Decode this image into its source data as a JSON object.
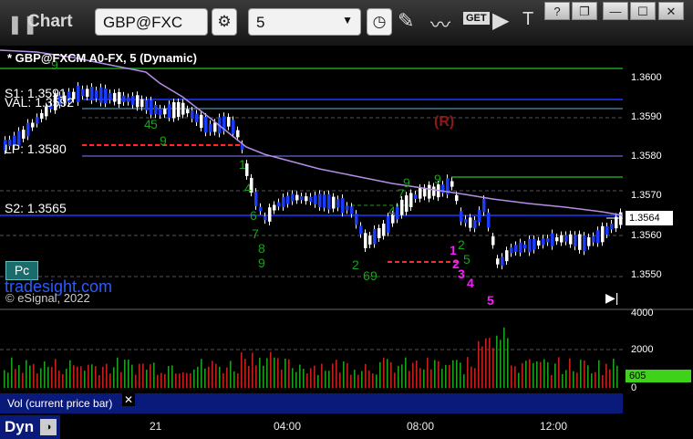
{
  "window": {
    "title": "Chart",
    "symbol": "GBP@FXC",
    "interval": "5",
    "win_buttons": [
      "?",
      "❐",
      "—",
      "☐",
      "✕"
    ]
  },
  "chart": {
    "header": "* GBP@FXCM A0-FX, 5 (Dynamic)",
    "labels": {
      "s1": "S1: 1.3591",
      "val": "VAL: 1.3592",
      "lp": "LP: 1.3580",
      "s2": "S2: 1.3565",
      "r_marker": "(R)",
      "brand": "tradesight.com",
      "copyright": "© eSignal, 2022",
      "pc": "Pc"
    },
    "price_ticks": [
      "1.3600",
      "1.3590",
      "1.3580",
      "1.3570",
      "1.3560",
      "1.3550"
    ],
    "current_price": "1.3564",
    "count_labels": [
      "1",
      "2",
      "3",
      "4",
      "5"
    ],
    "volume": {
      "label": "Vol (current price bar)",
      "ticks": [
        "4000",
        "2000",
        "0"
      ],
      "current": "605"
    },
    "time_ticks": [
      "21",
      "04:00",
      "08:00",
      "12:00"
    ],
    "footer": "Dyn",
    "colors": {
      "up": "#ffffff",
      "down": "#1a3cff",
      "ma": "#b48ee6",
      "green_line": "#1ea01e",
      "red_line": "#ff2a2a",
      "count": "#ff19ff",
      "seq": "#1aa31a",
      "vol_up": "#1e9e1e",
      "vol_down": "#c42020"
    }
  }
}
